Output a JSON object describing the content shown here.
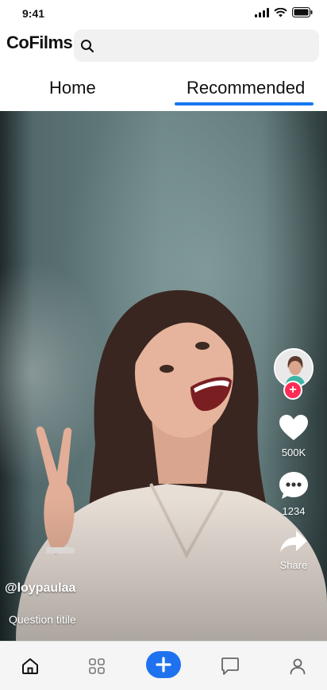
{
  "status_bar": {
    "time": "9:41"
  },
  "header": {
    "app_name": "CoFilms",
    "search_placeholder": ""
  },
  "tabs": [
    {
      "label": "Home",
      "active": false
    },
    {
      "label": "Recommended",
      "active": true
    }
  ],
  "video": {
    "username": "@loypaulaa",
    "title": "Question titile",
    "actions": {
      "likes": "500K",
      "comments": "1234",
      "share_label": "Share"
    }
  },
  "bottom_nav": {
    "items": [
      {
        "icon": "home-icon",
        "active": true
      },
      {
        "icon": "grid-icon",
        "active": false
      },
      {
        "icon": "plus-icon",
        "active": false
      },
      {
        "icon": "chat-icon",
        "active": false
      },
      {
        "icon": "profile-icon",
        "active": false
      }
    ]
  },
  "colors": {
    "accent": "#1677f0",
    "create_button": "#1e72ef",
    "follow_badge": "#fe2c55",
    "nav_background": "#f5f5f5"
  }
}
